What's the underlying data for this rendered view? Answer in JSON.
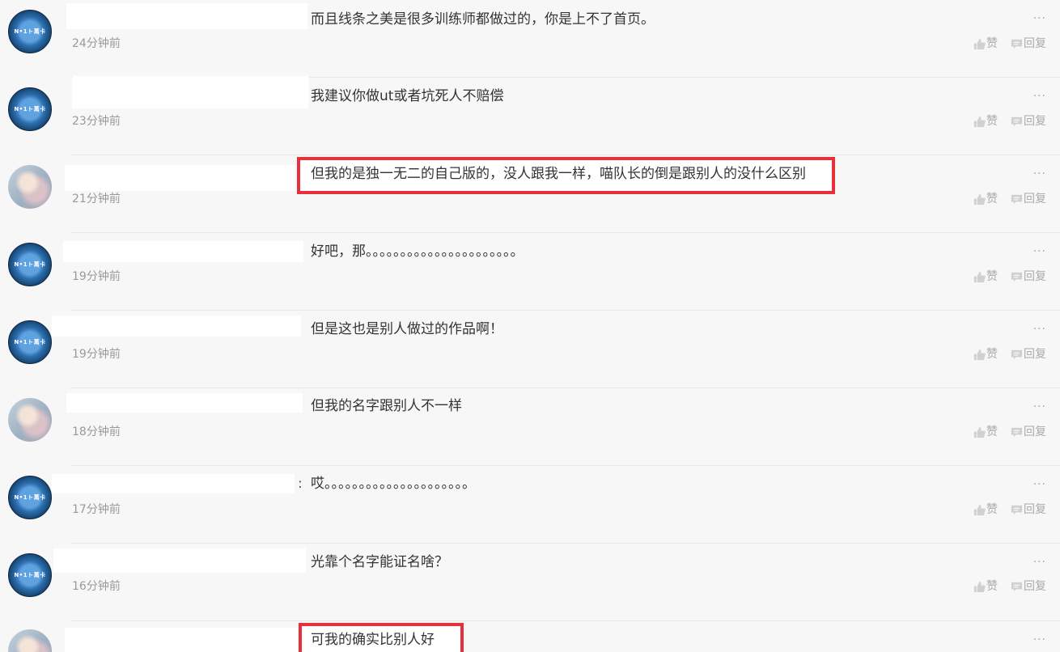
{
  "labels": {
    "like": "赞",
    "reply": "回复",
    "more": "···"
  },
  "comments": [
    {
      "avatar": "blue",
      "badge": "N•1ト萬卡",
      "text": "而且线条之美是很多训练师都做过的，你是上不了首页。",
      "time": "24分钟前"
    },
    {
      "avatar": "blue",
      "badge": "N•1ト萬卡",
      "text": "我建议你做ut或者坑死人不赔偿",
      "time": "23分钟前"
    },
    {
      "avatar": "girl",
      "text": "但我的是独一无二的自己版的，没人跟我一样，喵队长的倒是跟别人的没什么区别",
      "time": "21分钟前",
      "highlighted": true
    },
    {
      "avatar": "blue",
      "badge": "N•1ト萬卡",
      "text": "好吧，那。。。。。。。。。。。。。。。。。。。。。。",
      "time": "19分钟前"
    },
    {
      "avatar": "blue",
      "badge": "N•1ト萬卡",
      "text": "但是这也是别人做过的作品啊！",
      "time": "19分钟前"
    },
    {
      "avatar": "girl",
      "text": "但我的名字跟别人不一样",
      "time": "18分钟前"
    },
    {
      "avatar": "blue",
      "badge": "N•1ト萬卡",
      "text": "哎。。。。。。。。。。。。。。。。。。。。。",
      "time": "17分钟前",
      "colon": ":"
    },
    {
      "avatar": "blue",
      "badge": "N•1ト萬卡",
      "text": "光靠个名字能证名啥？",
      "time": "16分钟前"
    },
    {
      "avatar": "girl",
      "text": "可我的确实比别人好",
      "time": "",
      "highlighted": true
    }
  ]
}
